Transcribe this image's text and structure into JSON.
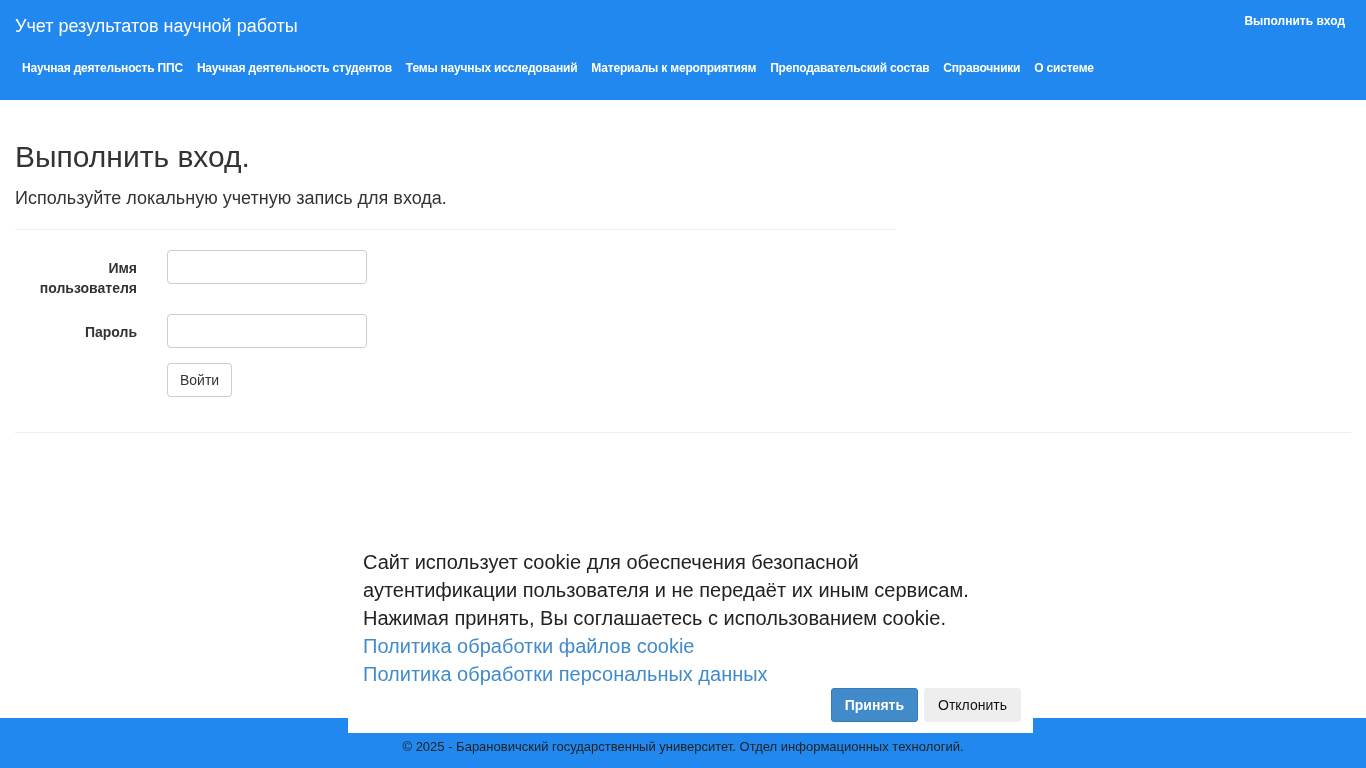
{
  "header": {
    "title": "Учет результатов научной работы",
    "login_link": "Выполнить вход",
    "nav": [
      "Научная деятельность ППС",
      "Научная деятельность студентов",
      "Темы научных исследований",
      "Материалы к мероприятиям",
      "Преподавательский состав",
      "Справочники",
      "О системе"
    ]
  },
  "page": {
    "heading": "Выполнить вход.",
    "subheading": "Используйте локальную учетную запись для входа.",
    "fields": [
      {
        "label": "Имя пользователя"
      },
      {
        "label": "Пароль"
      }
    ],
    "submit": "Войти"
  },
  "cookie_banner": {
    "text": "Сайт использует cookie для обеспечения безопасной аутентификации пользователя и не передаёт их иным сервисам. Нажимая принять, Вы соглашаетесь с использованием cookie.",
    "links": [
      "Политика обработки файлов cookie",
      "Политика обработки персональных данных"
    ],
    "buttons": [
      {
        "label": "Принять",
        "kind": "primary"
      },
      {
        "label": "Отклонить",
        "kind": "secondary"
      }
    ]
  },
  "footer": "© 2025 - Барановичский государственный университет. Отдел информационных технологий."
}
